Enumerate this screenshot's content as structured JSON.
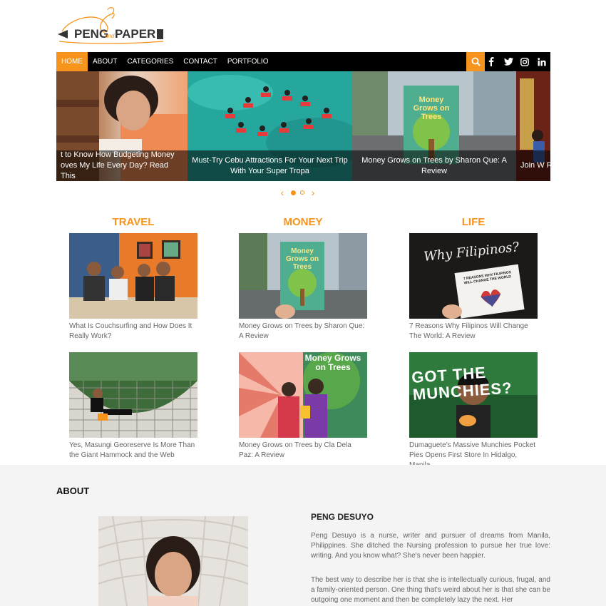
{
  "logo": {
    "peng": "PENG",
    "and": "and",
    "paper": "PAPER"
  },
  "nav": {
    "items": [
      "HOME",
      "ABOUT",
      "CATEGORIES",
      "CONTACT",
      "PORTFOLIO"
    ],
    "social": [
      "f",
      "t",
      "ig",
      "in"
    ]
  },
  "slider": {
    "captions": [
      "t to Know How Budgeting Money oves My Life Every Day? Read This",
      "Must-Try Cebu Attractions For Your Next Trip With Your Super Tropa",
      "Money Grows on Trees by Sharon Que: A Review",
      "Join W Recog"
    ]
  },
  "categories": [
    {
      "name": "TRAVEL",
      "posts": [
        "What Is Couchsurfing and How Does It Really Work?",
        "Yes, Masungi Georeserve Is More Than the Giant Hammock and the Web"
      ]
    },
    {
      "name": "MONEY",
      "posts": [
        "Money Grows on Trees by Sharon Que: A Review",
        "Money Grows on Trees by Cla Dela Paz: A Review"
      ]
    },
    {
      "name": "LIFE",
      "posts": [
        "7 Reasons Why Filipinos Will Change The World: A Review",
        "Dumaguete's Massive Munchies Pocket Pies Opens First Store In Hidalgo, Manila"
      ]
    }
  ],
  "images": {
    "book_title_1": "Money Grows on Trees",
    "why_filipinos": "Why Filipinos?",
    "book_cover_small": "7 REASONS WHY FILIPINOS WILL CHANGE THE WORLD",
    "got_munchies": "GOT THE MUNCHIES?"
  },
  "about": {
    "heading": "ABOUT",
    "name": "PENG DESUYO",
    "p1": "Peng Desuyo is a nurse, writer and pursuer of dreams from Manila, Philippines. She ditched the Nursing profession to pursue her true love: writing. And you know what? She's never been happier.",
    "p2": "The best way to describe her is that she is intellectually curious, frugal, and a family-oriented person. One thing that's weird about her is that she can be outgoing one moment and then be completely lazy the next. Her"
  },
  "colors": {
    "accent": "#f7941d",
    "nav_bg": "#000000",
    "about_bg": "#f4f4f4"
  }
}
